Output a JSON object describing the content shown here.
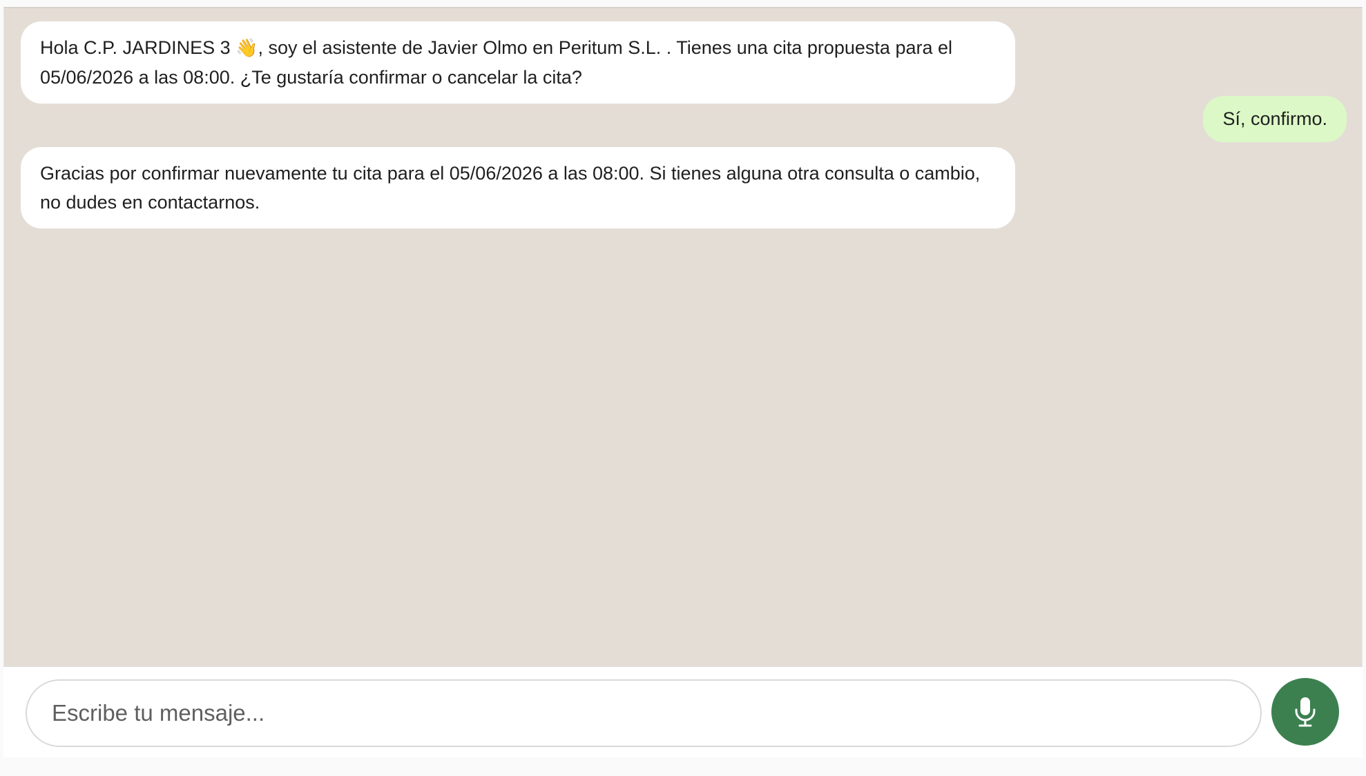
{
  "conversation": {
    "messages": [
      {
        "sender": "bot",
        "text_before_emoji": "Hola C.P. JARDINES 3 ",
        "emoji": "👋",
        "text_after_emoji": ", soy el asistente de Javier Olmo en Peritum S.L. . Tienes una cita propuesta para el 05/06/2026 a las 08:00. ¿Te gustaría confirmar o cancelar la cita?"
      },
      {
        "sender": "user",
        "text": "Sí, confirmo."
      },
      {
        "sender": "bot",
        "text": "Gracias por confirmar nuevamente tu cita para el 05/06/2026 a las 08:00. Si tienes alguna otra consulta o cambio, no dudes en contactarnos."
      }
    ]
  },
  "composer": {
    "placeholder": "Escribe tu mensaje...",
    "value": "",
    "mic_icon": "microphone-icon"
  },
  "colors": {
    "chat_background": "#e4ddd6",
    "bot_bubble": "#ffffff",
    "user_bubble": "#dcf8c6",
    "mic_button": "#3c8050"
  }
}
